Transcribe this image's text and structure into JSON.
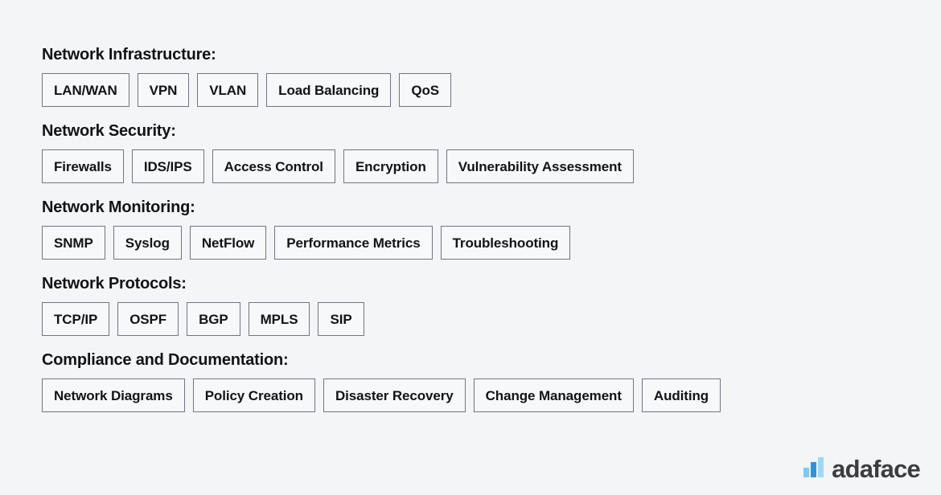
{
  "page": {
    "background_color": "#f4f5f7",
    "text_color": "#111316",
    "chip_border_color": "#6e7683"
  },
  "sections": [
    {
      "heading": "Network Infrastructure:",
      "chips": [
        "LAN/WAN",
        "VPN",
        "VLAN",
        "Load Balancing",
        "QoS"
      ]
    },
    {
      "heading": "Network Security:",
      "chips": [
        "Firewalls",
        "IDS/IPS",
        "Access Control",
        "Encryption",
        "Vulnerability Assessment"
      ]
    },
    {
      "heading": "Network Monitoring:",
      "chips": [
        "SNMP",
        "Syslog",
        "NetFlow",
        "Performance Metrics",
        "Troubleshooting"
      ]
    },
    {
      "heading": "Network Protocols:",
      "chips": [
        "TCP/IP",
        "OSPF",
        "BGP",
        "MPLS",
        "SIP"
      ]
    },
    {
      "heading": "Compliance and Documentation:",
      "chips": [
        "Network Diagrams",
        "Policy Creation",
        "Disaster Recovery",
        "Change Management",
        "Auditing"
      ]
    }
  ],
  "logo": {
    "wordmark": "adaface",
    "icon_name": "bar-chart-icon",
    "wordmark_color": "#3d3d3d",
    "bar_colors": [
      "#7ec8f2",
      "#2f93e0",
      "#9ed8f7"
    ]
  }
}
